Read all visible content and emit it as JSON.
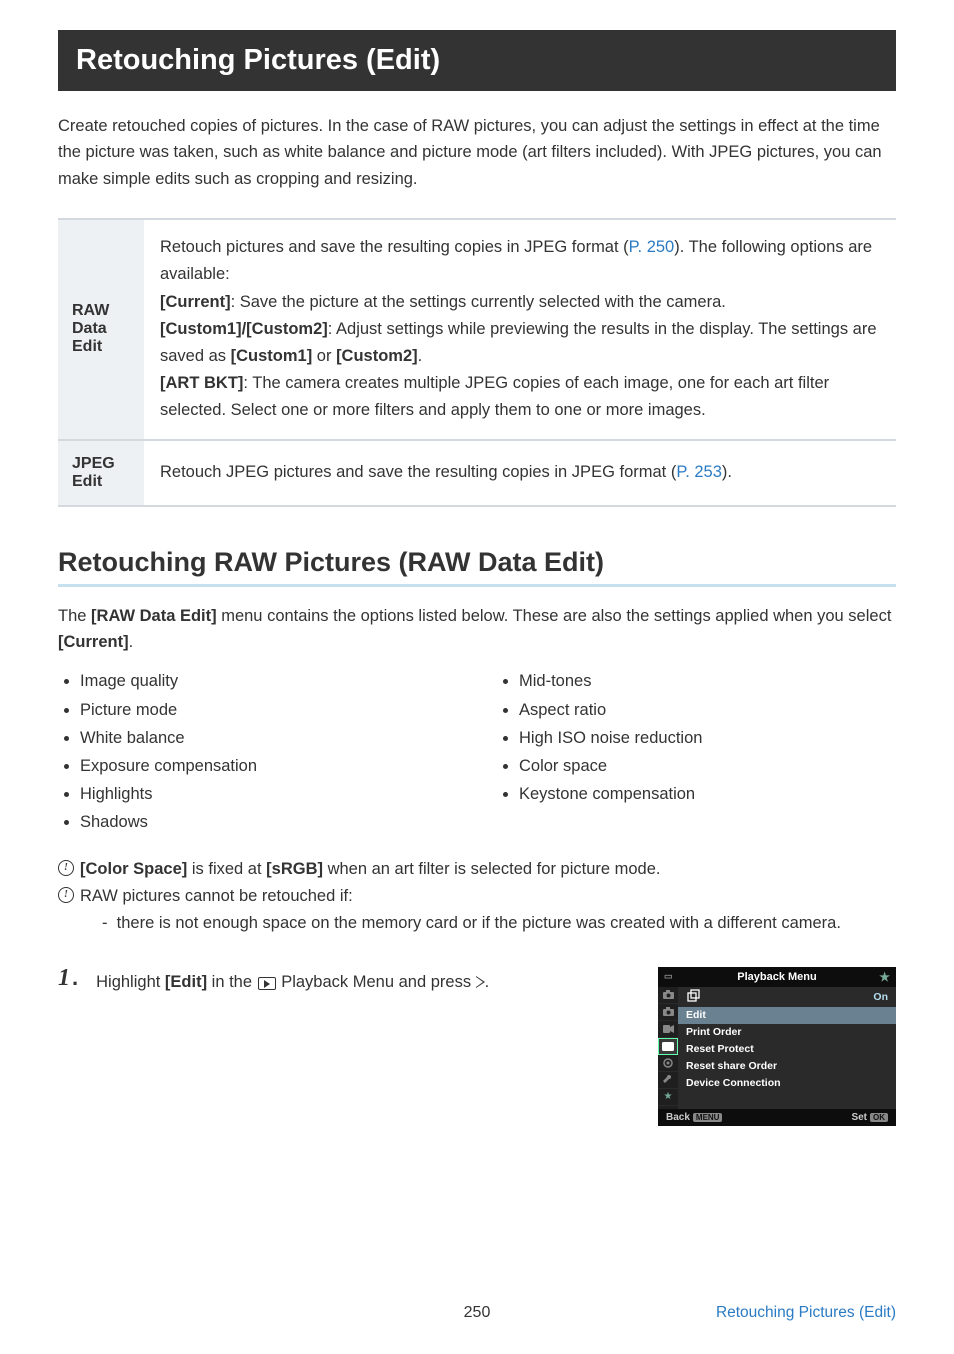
{
  "title": "Retouching Pictures (Edit)",
  "intro": "Create retouched copies of pictures. In the case of RAW pictures, you can adjust the settings in effect at the time the picture was taken, such as white balance and picture mode (art filters included). With JPEG pictures, you can make simple edits such as cropping and resizing.",
  "table": {
    "row1": {
      "header": "RAW Data Edit",
      "line1a": "Retouch pictures and save the resulting copies in JPEG format (",
      "link1": "P. 250",
      "line1b": "). The following options are available:",
      "current_label": "[Current]",
      "current_text": ": Save the picture at the settings currently selected with the camera.",
      "custom_label": "[Custom1]/[Custom2]",
      "custom_text_a": ": Adjust settings while previewing the results in the display. The settings are saved as ",
      "custom_bold1": "[Custom1]",
      "custom_or": " or ",
      "custom_bold2": "[Custom2]",
      "custom_dot": ".",
      "art_label": "[ART BKT]",
      "art_text": ": The camera creates multiple JPEG copies of each image, one for each art filter selected. Select one or more filters and apply them to one or more images."
    },
    "row2": {
      "header": "JPEG Edit",
      "text_a": "Retouch JPEG pictures and save the resulting copies in JPEG format (",
      "link": "P. 253",
      "text_b": ")."
    }
  },
  "h2": "Retouching RAW Pictures (RAW Data Edit)",
  "para2a": "The ",
  "para2b": "[RAW Data Edit]",
  "para2c": " menu contains the options listed below. These are also the settings applied when you select ",
  "para2d": "[Current]",
  "para2e": ".",
  "bullets_left": [
    "Image quality",
    "Picture mode",
    "White balance",
    "Exposure compensation",
    "Highlights",
    "Shadows"
  ],
  "bullets_right": [
    "Mid-tones",
    "Aspect ratio",
    "High ISO noise reduction",
    "Color space",
    "Keystone compensation"
  ],
  "note1a": "[Color Space]",
  "note1b": " is fixed at ",
  "note1c": "[sRGB]",
  "note1d": " when an art filter is selected for picture mode.",
  "note2": "RAW pictures cannot be retouched if:",
  "note2sub": "there is not enough space on the memory card or if the picture was created with a different camera.",
  "step1_a": "Highlight ",
  "step1_b": "[Edit]",
  "step1_c": " in the ",
  "step1_d": " Playback Menu and press ",
  "step1_e": ".",
  "menu": {
    "title": "Playback Menu",
    "items": [
      {
        "icon": "rotate",
        "value": "On"
      },
      {
        "label": "Edit",
        "selected": true
      },
      {
        "label": "Print Order"
      },
      {
        "label": "Reset Protect"
      },
      {
        "label": "Reset share Order"
      },
      {
        "label": "Device Connection"
      }
    ],
    "back": "Back",
    "back_badge": "MENU",
    "set": "Set",
    "set_badge": "OK"
  },
  "page_number": "250",
  "footer_link": "Retouching Pictures (Edit)"
}
